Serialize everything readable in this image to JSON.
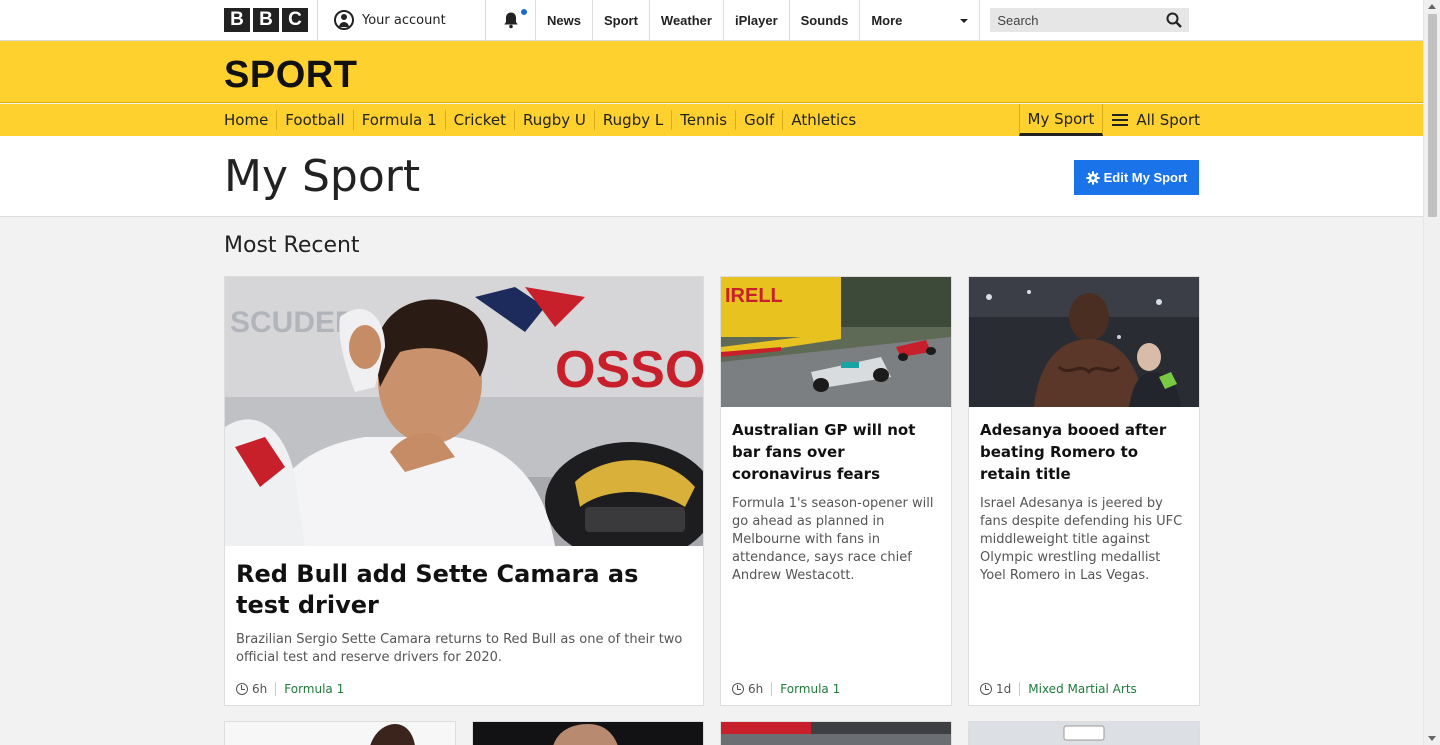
{
  "topbar": {
    "logo_letters": [
      "B",
      "B",
      "C"
    ],
    "account_label": "Your account",
    "nav": [
      "News",
      "Sport",
      "Weather",
      "iPlayer",
      "Sounds"
    ],
    "more_label": "More",
    "search_placeholder": "Search"
  },
  "sport_header": {
    "title": "SPORT",
    "nav": [
      "Home",
      "Football",
      "Formula 1",
      "Cricket",
      "Rugby U",
      "Rugby L",
      "Tennis",
      "Golf",
      "Athletics"
    ],
    "my_sport": "My Sport",
    "all_sport": "All Sport"
  },
  "page": {
    "title": "My Sport",
    "edit_button": "Edit My Sport",
    "section_heading": "Most Recent"
  },
  "cards": [
    {
      "headline": "Red Bull add Sette Camara as test driver",
      "summary": "Brazilian Sergio Sette Camara returns to Red Bull as one of their two official test and reserve drivers for 2020.",
      "time": "6h",
      "tag": "Formula 1"
    },
    {
      "headline": "Australian GP will not bar fans over coronavirus fears",
      "summary": "Formula 1's season-opener will go ahead as planned in Melbourne with fans in attendance, says race chief Andrew Westacott.",
      "time": "6h",
      "tag": "Formula 1"
    },
    {
      "headline": "Adesanya booed after beating Romero to retain title",
      "summary": "Israel Adesanya is jeered by fans despite defending his UFC middleweight title against Olympic wrestling medallist Yoel Romero in Las Vegas.",
      "time": "1d",
      "tag": "Mixed Martial Arts"
    }
  ],
  "colors": {
    "sport_yellow": "#fed12f",
    "edit_button_blue": "#1a73e8",
    "tag_green": "#1f7a3a"
  }
}
